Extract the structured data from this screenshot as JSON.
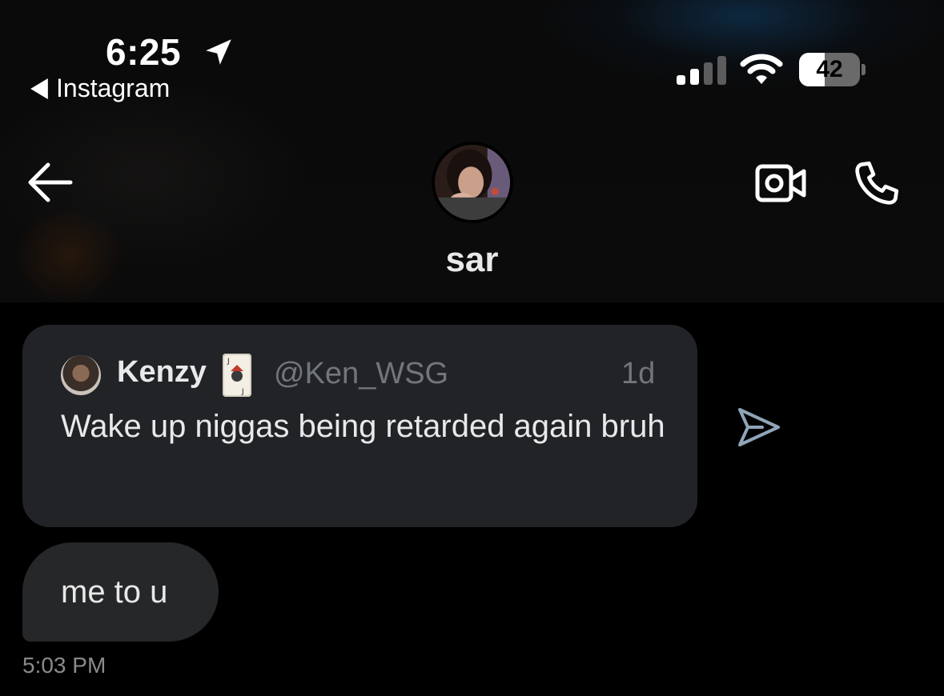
{
  "status_bar": {
    "time": "6:25",
    "back_app_label": "Instagram",
    "battery_level": "42",
    "battery_fraction": 0.42
  },
  "thread_header": {
    "contact_name": "sar"
  },
  "shared_post": {
    "author_name": "Kenzy",
    "author_handle": "@Ken_WSG",
    "age": "1d",
    "text": "Wake up niggas being retarded again bruh"
  },
  "message": {
    "text": "me to u",
    "timestamp": "5:03 PM"
  },
  "colors": {
    "background": "#000000",
    "card": "#212327",
    "bubble": "#262729",
    "share_icon": "#8fa4b8"
  }
}
